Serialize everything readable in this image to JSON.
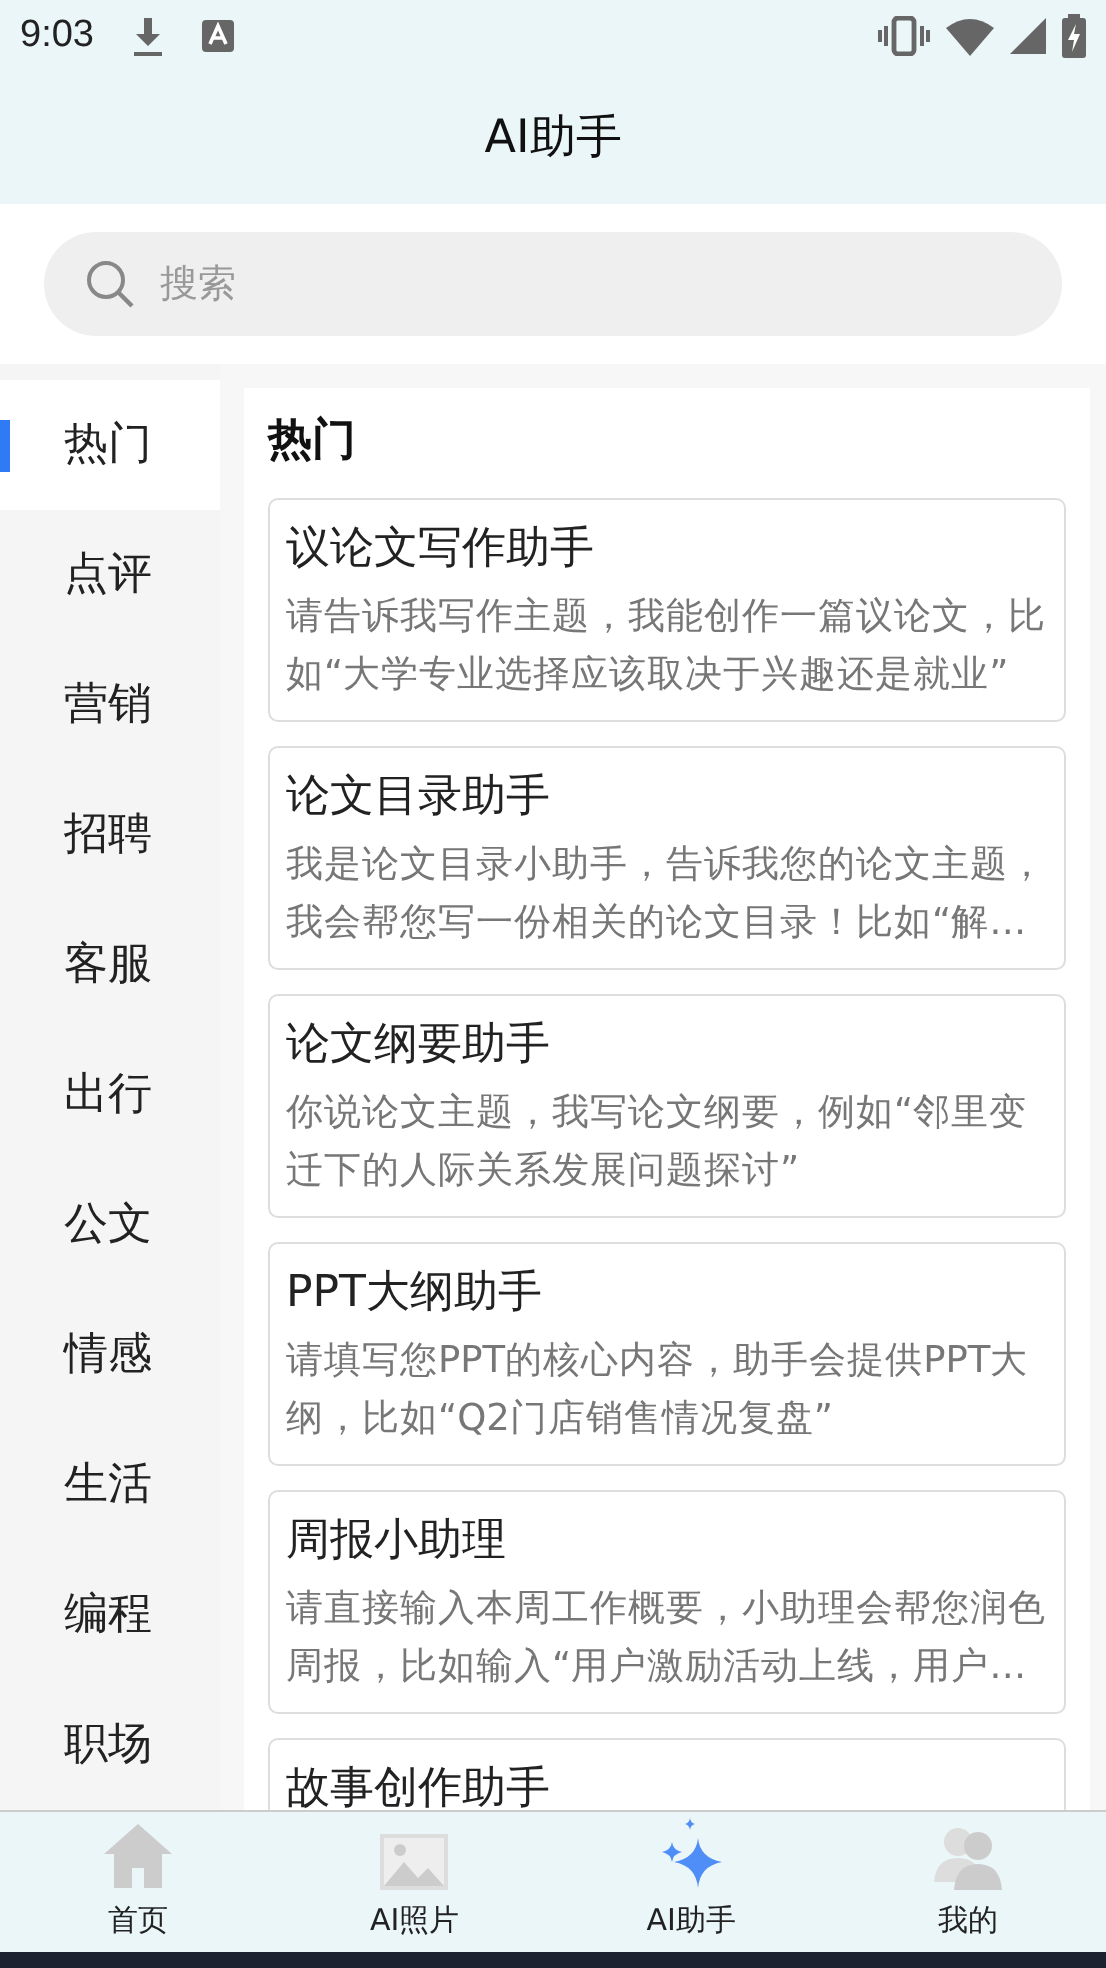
{
  "status_bar": {
    "time": "9:03"
  },
  "header": {
    "title": "AI助手"
  },
  "search": {
    "placeholder": "搜索"
  },
  "sidebar": {
    "items": [
      {
        "label": "热门",
        "selected": true
      },
      {
        "label": "点评",
        "selected": false
      },
      {
        "label": "营销",
        "selected": false
      },
      {
        "label": "招聘",
        "selected": false
      },
      {
        "label": "客服",
        "selected": false
      },
      {
        "label": "出行",
        "selected": false
      },
      {
        "label": "公文",
        "selected": false
      },
      {
        "label": "情感",
        "selected": false
      },
      {
        "label": "生活",
        "selected": false
      },
      {
        "label": "编程",
        "selected": false
      },
      {
        "label": "职场",
        "selected": false
      }
    ]
  },
  "section": {
    "title": "热门",
    "cards": [
      {
        "title": "议论文写作助手",
        "description": "请告诉我写作主题，我能创作一篇议论文，比如“大学专业选择应该取决于兴趣还是就业”"
      },
      {
        "title": "论文目录助手",
        "description": "我是论文目录小助手，告诉我您的论文主题，我会帮您写一份相关的论文目录！比如“解…"
      },
      {
        "title": "论文纲要助手",
        "description": "你说论文主题，我写论文纲要，例如“邻里变迁下的人际关系发展问题探讨”"
      },
      {
        "title": "PPT大纲助手",
        "description": "请填写您PPT的核心内容，助手会提供PPT大纲，比如“Q2门店销售情况复盘”"
      },
      {
        "title": "周报小助理",
        "description": "请直接输入本周工作概要，小助理会帮您润色周报，比如输入“用户激励活动上线，用户…"
      },
      {
        "title": "故事创作助手"
      }
    ]
  },
  "tab_bar": {
    "items": [
      {
        "kind": "home",
        "label": "首页",
        "selected": false
      },
      {
        "kind": "photo",
        "label": "AI照片",
        "selected": false
      },
      {
        "kind": "sparkle",
        "label": "AI助手",
        "selected": true
      },
      {
        "kind": "people",
        "label": "我的",
        "selected": false
      }
    ]
  }
}
